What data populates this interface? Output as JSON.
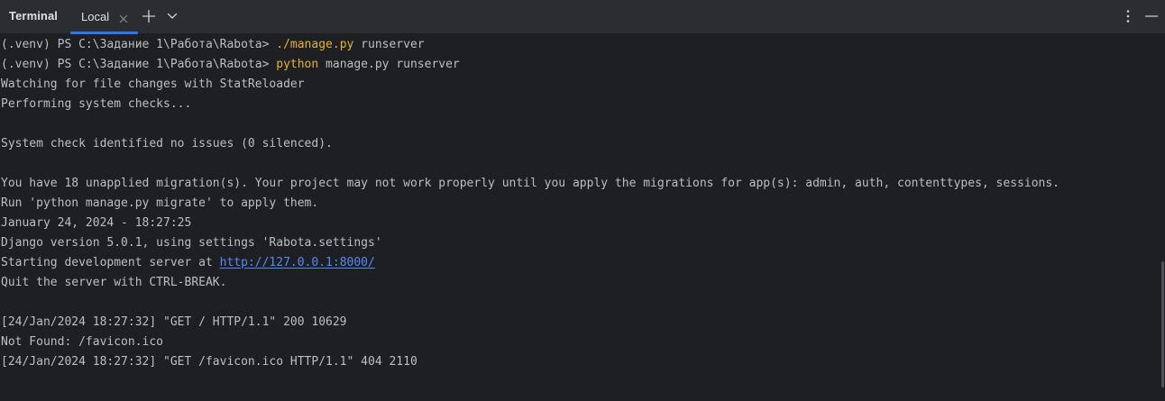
{
  "header": {
    "panel_title": "Terminal",
    "tab_label": "Local",
    "accent_color": "#3574f0",
    "icons": {
      "tab_close": "close-icon",
      "new_tab": "plus-icon",
      "tab_menu": "chevron-down-icon",
      "options": "more-vertical-icon",
      "hide": "minimize-icon"
    }
  },
  "terminal": {
    "lines": [
      {
        "prompt": "(.venv) PS C:\\Задание 1\\Работа\\Rabota> ",
        "command": "./manage.py",
        "args": " runserver"
      },
      {
        "prompt": "(.venv) PS C:\\Задание 1\\Работа\\Rabota> ",
        "command": "python",
        "args": " manage.py runserver"
      },
      {
        "text": "Watching for file changes with StatReloader"
      },
      {
        "text": "Performing system checks..."
      },
      {
        "text": ""
      },
      {
        "text": "System check identified no issues (0 silenced)."
      },
      {
        "text": ""
      },
      {
        "text": "You have 18 unapplied migration(s). Your project may not work properly until you apply the migrations for app(s): admin, auth, contenttypes, sessions."
      },
      {
        "text": "Run 'python manage.py migrate' to apply them."
      },
      {
        "text": "January 24, 2024 - 18:27:25"
      },
      {
        "text": "Django version 5.0.1, using settings 'Rabota.settings'"
      },
      {
        "text": "Starting development server at ",
        "link": "http://127.0.0.1:8000/"
      },
      {
        "text": "Quit the server with CTRL-BREAK."
      },
      {
        "text": ""
      },
      {
        "text": "[24/Jan/2024 18:27:32] \"GET / HTTP/1.1\" 200 10629"
      },
      {
        "text": "Not Found: /favicon.ico"
      },
      {
        "text": "[24/Jan/2024 18:27:32] \"GET /favicon.ico HTTP/1.1\" 404 2110"
      }
    ],
    "colors": {
      "text": "#bcbec4",
      "command": "#e5b339",
      "link": "#548af7",
      "background": "#1e1f22"
    }
  }
}
